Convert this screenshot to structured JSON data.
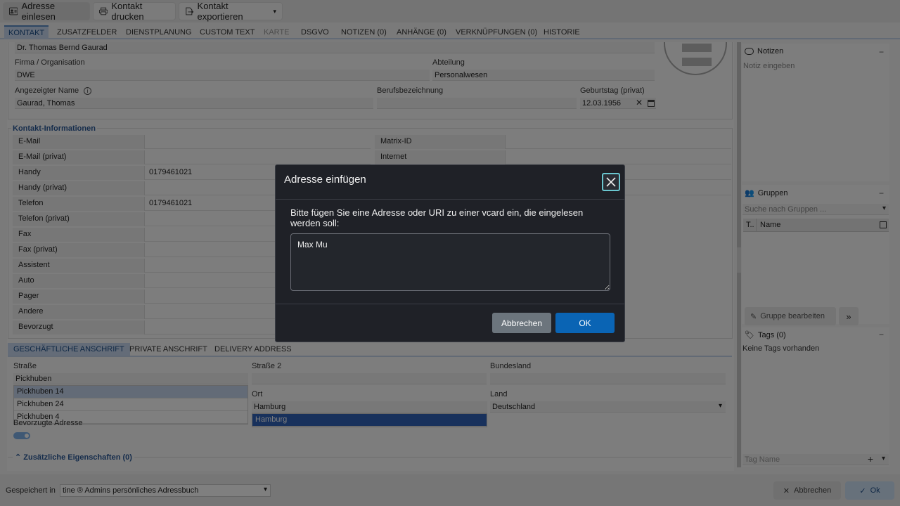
{
  "toolbar": {
    "read_address": "Adresse einlesen",
    "print_contact": "Kontakt drucken",
    "export_contact": "Kontakt exportieren"
  },
  "tabs": [
    "KONTAKT",
    "ZUSATZFELDER",
    "DIENSTPLANUNG",
    "CUSTOM TEXT",
    "KARTE",
    "DSGVO",
    "NOTIZEN (0)",
    "ANHÄNGE (0)",
    "VERKNÜPFUNGEN (0)",
    "HISTORIE"
  ],
  "header_fields": {
    "full_name": "Dr. Thomas Bernd Gaurad",
    "company_label": "Firma / Organisation",
    "company": "DWE",
    "department_label": "Abteilung",
    "department": "Personalwesen",
    "display_name_label": "Angezeigter Name",
    "display_name": "Gaurad, Thomas",
    "job_title_label": "Berufsbezeichnung",
    "job_title": "",
    "birthday_label": "Geburtstag (privat)",
    "birthday": "12.03.1956"
  },
  "contact_info": {
    "title": "Kontakt-Informationen",
    "left": [
      {
        "label": "E-Mail",
        "value": ""
      },
      {
        "label": "E-Mail (privat)",
        "value": ""
      },
      {
        "label": "Handy",
        "value": "0179461021"
      },
      {
        "label": "Handy (privat)",
        "value": ""
      },
      {
        "label": "Telefon",
        "value": "0179461021"
      },
      {
        "label": "Telefon (privat)",
        "value": ""
      },
      {
        "label": "Fax",
        "value": ""
      },
      {
        "label": "Fax (privat)",
        "value": ""
      },
      {
        "label": "Assistent",
        "value": ""
      },
      {
        "label": "Auto",
        "value": ""
      },
      {
        "label": "Pager",
        "value": ""
      },
      {
        "label": "Andere",
        "value": ""
      },
      {
        "label": "Bevorzugt",
        "value": ""
      }
    ],
    "right": [
      {
        "label": "Matrix-ID",
        "value": ""
      },
      {
        "label": "Internet",
        "value": ""
      }
    ]
  },
  "address": {
    "tabs": [
      "GESCHÄFTLICHE ANSCHRIFT",
      "PRIVATE ANSCHRIFT",
      "DELIVERY ADDRESS"
    ],
    "street_label": "Straße",
    "street_value": "Pickhuben",
    "street_suggestions": [
      "Pickhuben 14",
      "Pickhuben 24",
      "Pickhuben 4"
    ],
    "street2_label": "Straße 2",
    "state_label": "Bundesland",
    "city_label": "Ort",
    "city_value": "Hamburg",
    "city_suggestion": "Hamburg",
    "country_label": "Land",
    "country_value": "Deutschland",
    "preferred_label": "Bevorzugte Adresse",
    "preferred_on": true
  },
  "extra_props": "Zusätzliche Eigenschaften (0)",
  "sidebar": {
    "notes_title": "Notizen",
    "notes_placeholder": "Notiz eingeben",
    "groups_title": "Gruppen",
    "groups_search": "Suche nach Gruppen ...",
    "groups_col_t": "T..",
    "groups_col_name": "Name",
    "edit_group": "Gruppe bearbeiten",
    "tags_title": "Tags (0)",
    "tags_empty": "Keine Tags vorhanden",
    "tag_name_placeholder": "Tag Name"
  },
  "footer": {
    "saved_in_label": "Gespeichert in",
    "saved_in_value": "tine ® Admins persönliches Adressbuch",
    "cancel": "Abbrechen",
    "ok": "Ok"
  },
  "dialog": {
    "title": "Adresse einfügen",
    "prompt": "Bitte fügen Sie eine Adresse oder URI zu einer vcard ein, die eingelesen werden soll:",
    "input_value": "Max Mu",
    "cancel": "Abbrechen",
    "ok": "OK"
  },
  "colors": {
    "accent": "#2d5a99",
    "dialog_bg": "#1f2127",
    "ok_button": "#0a64b4",
    "cancel_button": "#6c757d",
    "close_focus": "#6ac6cf"
  }
}
